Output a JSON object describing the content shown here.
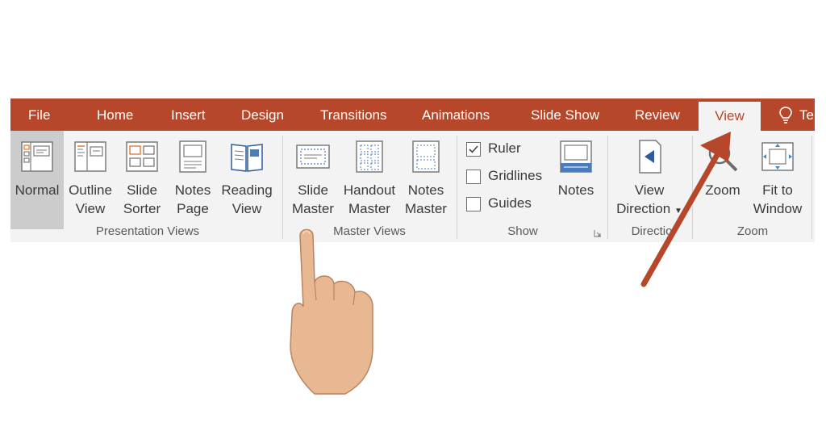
{
  "tabs": [
    {
      "label": "File"
    },
    {
      "label": "Home"
    },
    {
      "label": "Insert"
    },
    {
      "label": "Design"
    },
    {
      "label": "Transitions"
    },
    {
      "label": "Animations"
    },
    {
      "label": "Slide Show"
    },
    {
      "label": "Review"
    },
    {
      "label": "View",
      "active": true
    },
    {
      "label": "Te"
    }
  ],
  "groups": {
    "presentation_views": {
      "label": "Presentation Views",
      "buttons": [
        {
          "line1": "Normal",
          "line2": ""
        },
        {
          "line1": "Outline",
          "line2": "View"
        },
        {
          "line1": "Slide",
          "line2": "Sorter"
        },
        {
          "line1": "Notes",
          "line2": "Page"
        },
        {
          "line1": "Reading",
          "line2": "View"
        }
      ]
    },
    "master_views": {
      "label": "Master Views",
      "buttons": [
        {
          "line1": "Slide",
          "line2": "Master"
        },
        {
          "line1": "Handout",
          "line2": "Master"
        },
        {
          "line1": "Notes",
          "line2": "Master"
        }
      ]
    },
    "show": {
      "label": "Show",
      "checkboxes": [
        {
          "label": "Ruler",
          "checked": true
        },
        {
          "label": "Gridlines",
          "checked": false
        },
        {
          "label": "Guides",
          "checked": false
        }
      ],
      "notes_label": "Notes"
    },
    "direction": {
      "label": "Directio",
      "line1": "View",
      "line2": "Direction"
    },
    "zoom": {
      "label": "Zoom",
      "buttons": [
        {
          "line1": "Zoom",
          "line2": ""
        },
        {
          "line1": "Fit to",
          "line2": "Window"
        }
      ]
    }
  },
  "colors": {
    "accent": "#b7472a",
    "ribbon_bg": "#f3f3f3",
    "arrow": "#b7472a"
  },
  "icons": [
    "normal-view-icon",
    "outline-view-icon",
    "slide-sorter-icon",
    "notes-page-icon",
    "reading-view-icon",
    "slide-master-icon",
    "handout-master-icon",
    "notes-master-icon",
    "notes-icon",
    "view-direction-icon",
    "zoom-icon",
    "fit-to-window-icon",
    "lightbulb-icon",
    "dialog-launcher-icon"
  ]
}
